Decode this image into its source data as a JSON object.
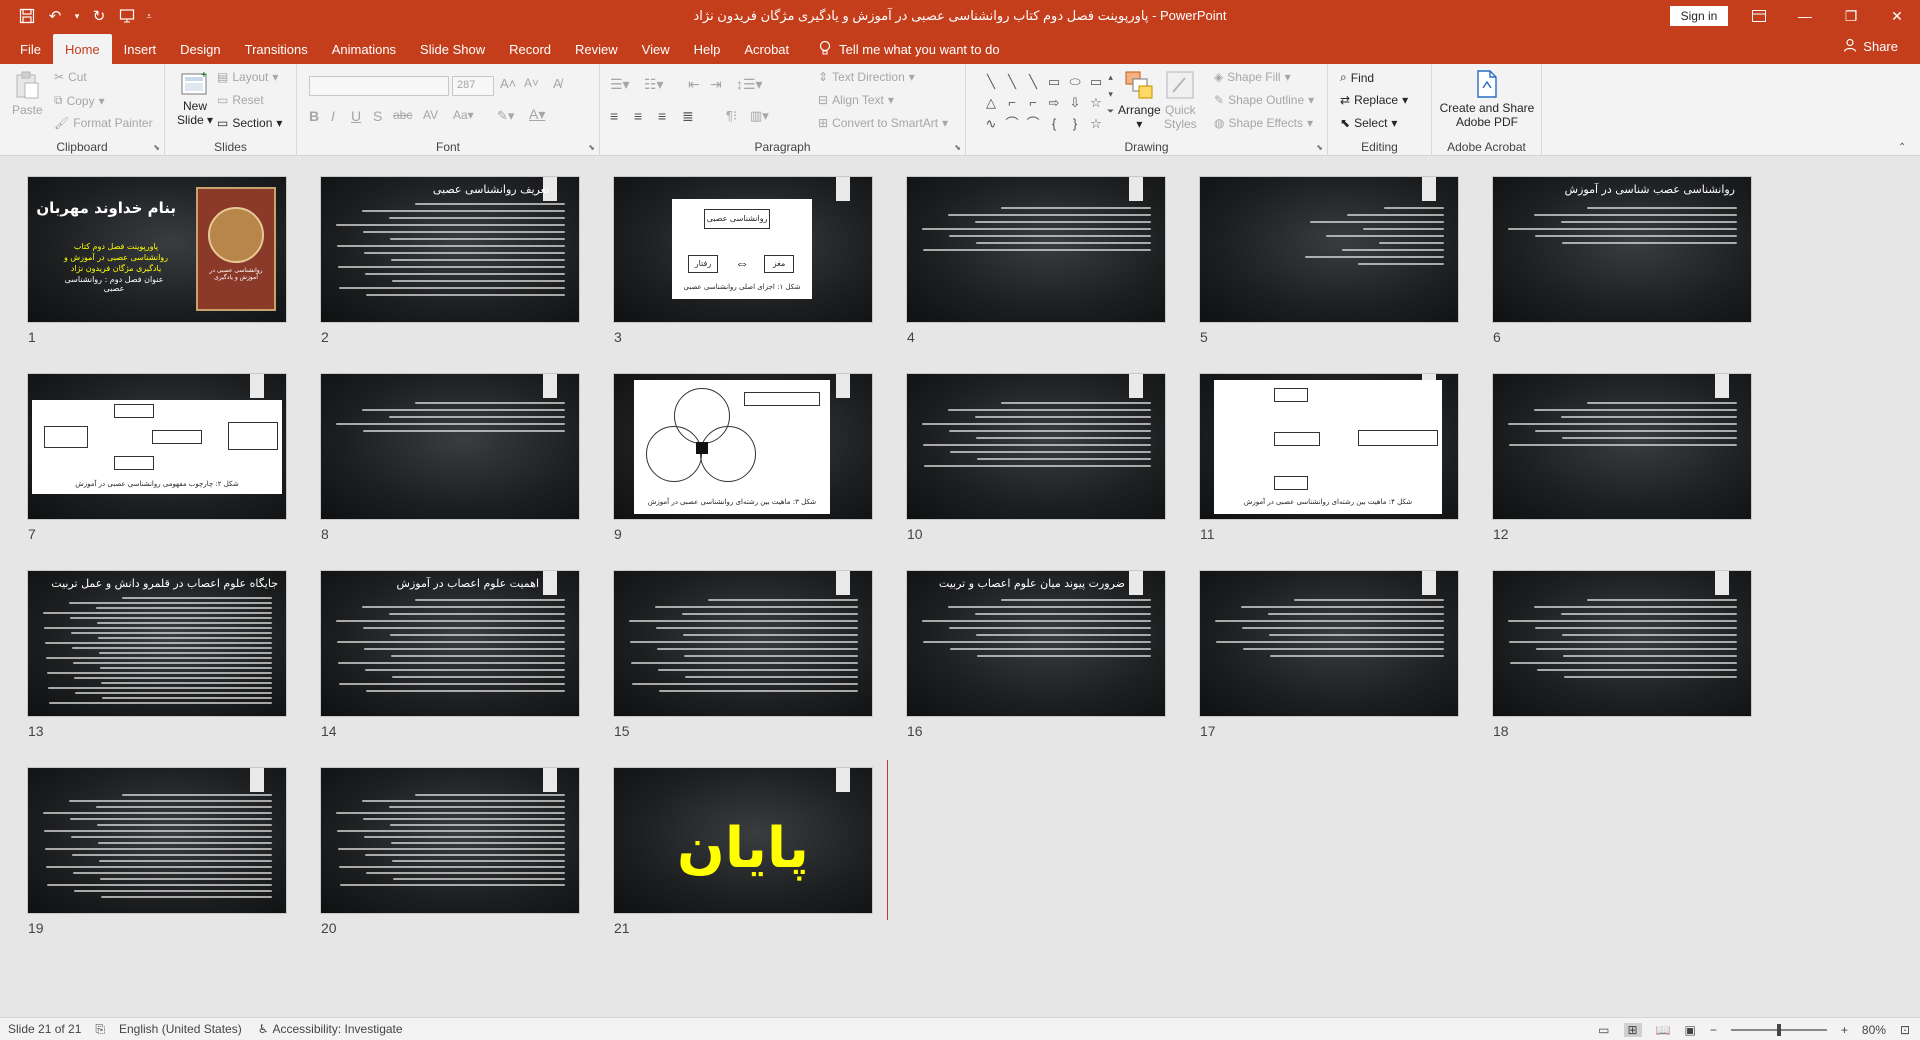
{
  "window": {
    "title": "پاورپوینت فصل دوم کتاب روانشناسی عصبی در آموزش و یادگیری مژگان فریدون نژاد  -  PowerPoint",
    "sign_in": "Sign in"
  },
  "tabs": [
    "File",
    "Home",
    "Insert",
    "Design",
    "Transitions",
    "Animations",
    "Slide Show",
    "Record",
    "Review",
    "View",
    "Help",
    "Acrobat"
  ],
  "active_tab": "Home",
  "tell_me": "Tell me what you want to do",
  "share": "Share",
  "ribbon": {
    "clipboard": {
      "label": "Clipboard",
      "paste": "Paste",
      "cut": "Cut",
      "copy": "Copy",
      "format_painter": "Format Painter"
    },
    "slides": {
      "label": "Slides",
      "new_slide": "New",
      "new_slide2": "Slide",
      "layout": "Layout",
      "reset": "Reset",
      "section": "Section"
    },
    "font": {
      "label": "Font",
      "font_size": "287"
    },
    "paragraph": {
      "label": "Paragraph",
      "text_direction": "Text Direction",
      "align_text": "Align Text",
      "convert_smartart": "Convert to SmartArt"
    },
    "drawing": {
      "label": "Drawing",
      "arrange": "Arrange",
      "quick_styles": "Quick",
      "quick_styles2": "Styles",
      "shape_fill": "Shape Fill",
      "shape_outline": "Shape Outline",
      "shape_effects": "Shape Effects"
    },
    "editing": {
      "label": "Editing",
      "find": "Find",
      "replace": "Replace",
      "select": "Select"
    },
    "acrobat": {
      "label": "Adobe Acrobat",
      "create_share": "Create and Share",
      "create_share2": "Adobe PDF"
    }
  },
  "slides": {
    "numbers": [
      "1",
      "2",
      "3",
      "4",
      "5",
      "6",
      "7",
      "8",
      "9",
      "10",
      "11",
      "12",
      "13",
      "14",
      "15",
      "16",
      "17",
      "18",
      "19",
      "20",
      "21"
    ],
    "s1_title": "بنام خداوند مهربان",
    "s1_sub": "پاورپوینت فصل دوم کتاب روانشناسی عصبی در آموزش و یادگیری مژگان فریدون نژاد",
    "s1_chapter": "عنوان فصل دوم : روانشناسی عصبی",
    "s1_book": "روانشناسی عصبی در آموزش و یادگیری",
    "s2_title": "تعریف روانشناسی عصبی",
    "s3_top": "روانشناسی عصبی",
    "s3_left": "رفتار",
    "s3_right": "مغز",
    "s3_caption": "شکل ۱: اجزای اصلی روانشناسی عصبی",
    "s6_title": "روانشناسی عصب شناسی در آموزش",
    "s7_caption": "شکل ۲: چارچوب مفهومی روانشناسی عصبی در آموزش",
    "s9_caption": "شکل ۳: ماهیت بین رشته‌ای روانشناسی عصبی در آموزش",
    "s11_caption": "شکل ۴: ماهیت بین رشته‌ای روانشناسی عصبی در آموزش",
    "s13_title": "جایگاه علوم اعصاب در قلمرو دانش و عمل تربیت",
    "s14_title": "اهمیت علوم اعصاب در آموزش",
    "s16_title": "ضرورت پیوند میان علوم اعصاب و تربیت",
    "s21_title": "پایان"
  },
  "status": {
    "slide_of": "Slide 21 of 21",
    "language": "English (United States)",
    "accessibility": "Accessibility: Investigate",
    "zoom": "80%"
  },
  "colors": {
    "accent": "#c43e1c",
    "end_text": "#ffff00"
  }
}
